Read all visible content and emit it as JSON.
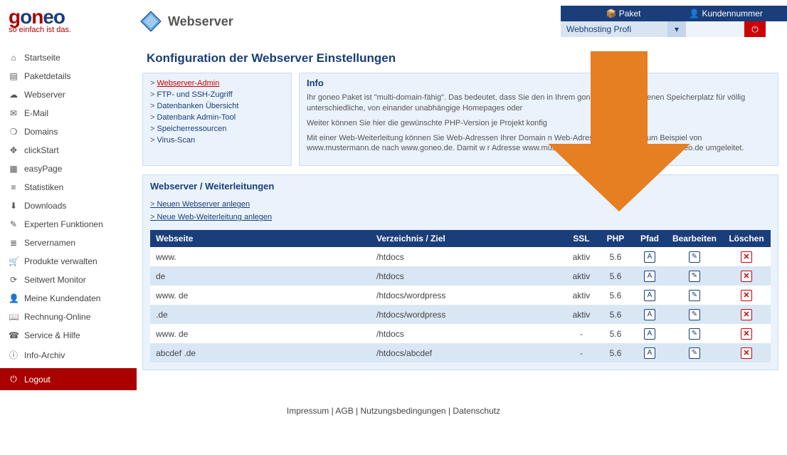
{
  "brand": {
    "name_html": "goneo",
    "sub": "so einfach ist das."
  },
  "header": {
    "title": "Webserver",
    "paket_label": "Paket",
    "kunde_label": "Kundennummer",
    "paket_value": "Webhosting Profi"
  },
  "sidebar": {
    "items": [
      {
        "icon": "⌂",
        "label": "Startseite",
        "name": "sidebar-item-startseite"
      },
      {
        "icon": "▤",
        "label": "Paketdetails",
        "name": "sidebar-item-paketdetails"
      },
      {
        "icon": "☁",
        "label": "Webserver",
        "name": "sidebar-item-webserver"
      },
      {
        "icon": "✉",
        "label": "E-Mail",
        "name": "sidebar-item-email"
      },
      {
        "icon": "❍",
        "label": "Domains",
        "name": "sidebar-item-domains"
      },
      {
        "icon": "✥",
        "label": "clickStart",
        "name": "sidebar-item-clickstart"
      },
      {
        "icon": "▦",
        "label": "easyPage",
        "name": "sidebar-item-easypage"
      },
      {
        "icon": "≡",
        "label": "Statistiken",
        "name": "sidebar-item-statistiken"
      },
      {
        "icon": "⬇",
        "label": "Downloads",
        "name": "sidebar-item-downloads"
      },
      {
        "icon": "✎",
        "label": "Experten Funktionen",
        "name": "sidebar-item-experten"
      },
      {
        "icon": "≣",
        "label": "Servernamen",
        "name": "sidebar-item-servernamen"
      },
      {
        "icon": "🛒",
        "label": "Produkte verwalten",
        "name": "sidebar-item-produkte"
      },
      {
        "icon": "⟳",
        "label": "Seitwert Monitor",
        "name": "sidebar-item-seitwert"
      },
      {
        "icon": "👤",
        "label": "Meine Kundendaten",
        "name": "sidebar-item-kundendaten"
      },
      {
        "icon": "📖",
        "label": "Rechnung-Online",
        "name": "sidebar-item-rechnung"
      },
      {
        "icon": "☎",
        "label": "Service & Hilfe",
        "name": "sidebar-item-service"
      },
      {
        "icon": "ⓘ",
        "label": "Info-Archiv",
        "name": "sidebar-item-infoarchiv"
      }
    ],
    "logout": {
      "icon": "⏻",
      "label": "Logout"
    }
  },
  "page": {
    "title": "Konfiguration der Webserver Einstellungen",
    "subnav": [
      {
        "label": "Webserver-Admin",
        "active": true
      },
      {
        "label": "FTP- und SSH-Zugriff"
      },
      {
        "label": "Datenbanken Übersicht"
      },
      {
        "label": "Datenbank Admin-Tool"
      },
      {
        "label": "Speicherressourcen"
      },
      {
        "label": "Virus-Scan"
      }
    ],
    "info": {
      "heading": "Info",
      "p1": "Ihr goneo Paket ist \"multi-domain-fähig\". Das bedeutet, dass Sie den in Ihrem goneo Paket enthaltenen Speicherplatz für völlig unterschiedliche, von einander unabhängige Homepages oder",
      "p2": "Weiter können Sie hier die gewünschte PHP-Version je Projekt konfig",
      "p3": "Mit einer Web-Weiterleitung können Sie Web-Adressen Ihrer Domain                              n Web-Adressen umleiten. Zum Beispiel von www.mustermann.de nach www.goneo.de. Damit w                           r Adresse www.mustermann.de im Browser auf www.goneo.de umgeleitet."
    },
    "section": {
      "heading": "Webserver / Weiterleitungen",
      "link1": "Neuen Webserver anlegen",
      "link2": "Neue Web-Weiterleitung anlegen",
      "columns": {
        "webseite": "Webseite",
        "verzeichnis": "Verzeichnis / Ziel",
        "ssl": "SSL",
        "php": "PHP",
        "pfad": "Pfad",
        "bearbeiten": "Bearbeiten",
        "loeschen": "Löschen"
      },
      "rows": [
        {
          "webseite": "www.",
          "verzeichnis": "/htdocs",
          "ssl": "aktiv",
          "php": "5.6"
        },
        {
          "webseite": "              de",
          "verzeichnis": "/htdocs",
          "ssl": "aktiv",
          "php": "5.6"
        },
        {
          "webseite": "www.               de",
          "verzeichnis": "/htdocs/wordpress",
          "ssl": "aktiv",
          "php": "5.6"
        },
        {
          "webseite": "              .de",
          "verzeichnis": "/htdocs/wordpress",
          "ssl": "aktiv",
          "php": "5.6"
        },
        {
          "webseite": "www.                        de",
          "verzeichnis": "/htdocs",
          "ssl": "-",
          "php": "5.6"
        },
        {
          "webseite": "abcdef            .de",
          "verzeichnis": "/htdocs/abcdef",
          "ssl": "-",
          "php": "5.6"
        }
      ]
    }
  },
  "footer": {
    "impressum": "Impressum",
    "agb": "AGB",
    "nutzung": "Nutzungsbedingungen",
    "datenschutz": "Datenschutz"
  },
  "colors": {
    "primary": "#1a3e7a",
    "accent": "#c00",
    "arrow": "#e67e22"
  }
}
